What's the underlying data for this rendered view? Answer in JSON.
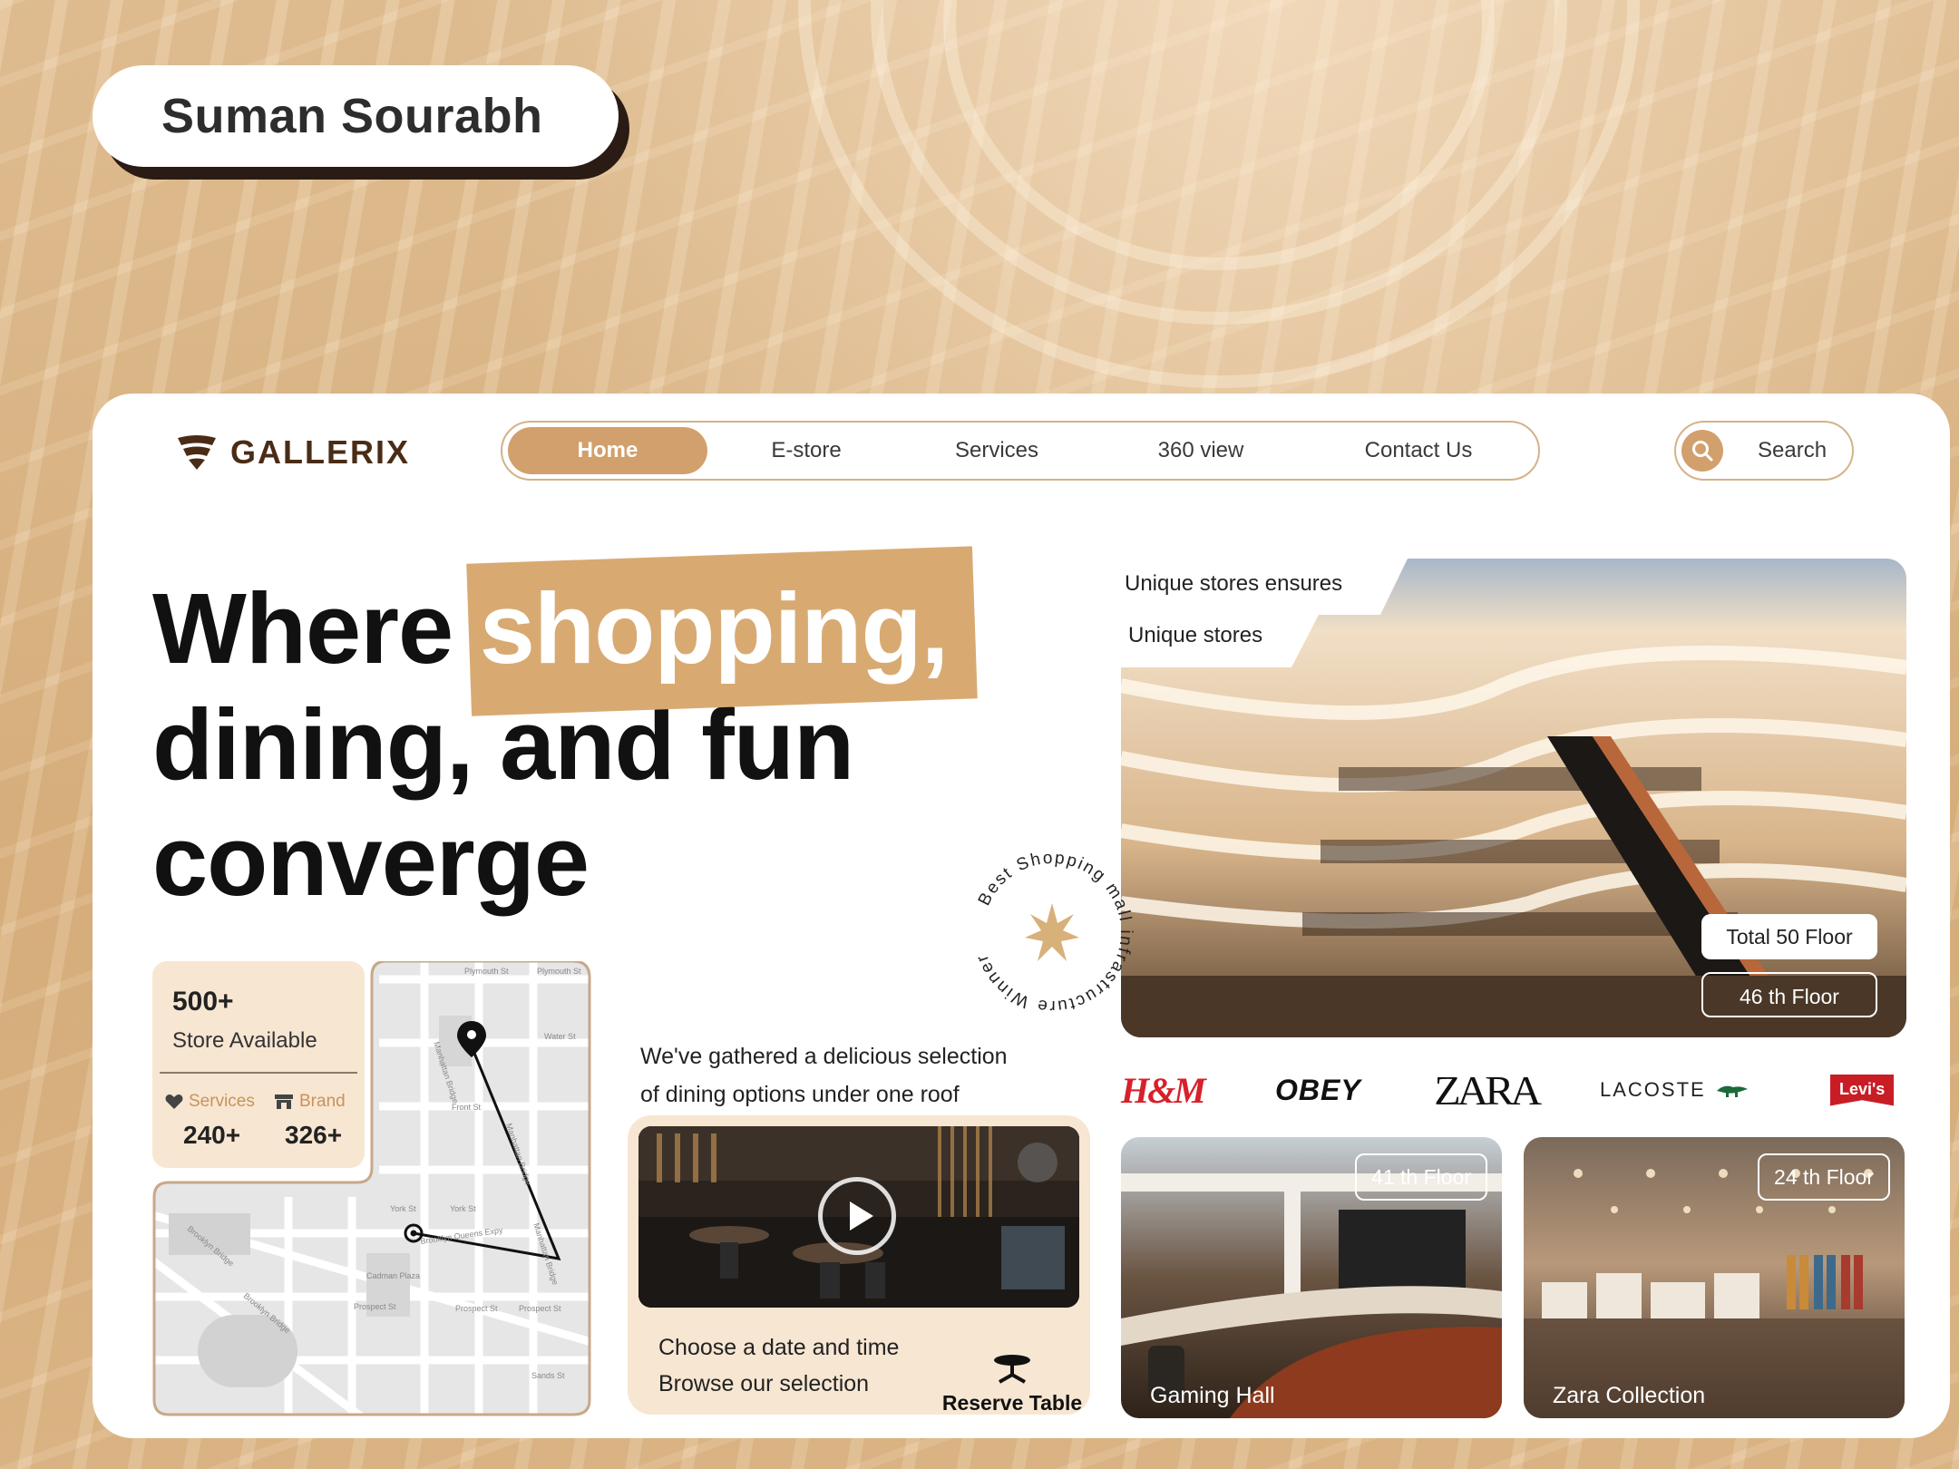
{
  "author": {
    "name": "Suman Sourabh"
  },
  "brand": {
    "name": "GALLERIX",
    "accent": "#d2a06c",
    "dark": "#4a2c16"
  },
  "nav": {
    "items": [
      {
        "label": "Home",
        "active": true
      },
      {
        "label": "E-store"
      },
      {
        "label": "Services"
      },
      {
        "label": "360 view"
      },
      {
        "label": "Contact Us"
      }
    ]
  },
  "search": {
    "label": "Search",
    "icon": "search-icon"
  },
  "hero": {
    "line1_prefix": "Where",
    "line1_highlight": "shopping,",
    "line2": "dining, and fun",
    "line3": "converge"
  },
  "stats": {
    "stores_count": "500+",
    "stores_label": "Store Available",
    "services_label": "Services",
    "services_count": "240+",
    "brand_label": "Brand",
    "brand_count": "326+"
  },
  "map": {
    "streets": [
      "Plymouth St",
      "Plymouth St",
      "Water St",
      "Front St",
      "York St",
      "York St",
      "Brooklyn Queens Expy",
      "Prospect St",
      "Prospect St",
      "Sands St",
      "Manhattan Bridge",
      "Jay St",
      "Pearl St",
      "Adams St",
      "Washington St",
      "Brooklyn Bridge",
      "Cadman Plaza"
    ]
  },
  "dining": {
    "intro_line1": "We've gathered a delicious selection",
    "intro_line2": "of dining options under one roof",
    "desc_line1": "Choose a date and time",
    "desc_line2": "Browse our selection",
    "reserve_label": "Reserve Table"
  },
  "gallery": {
    "tab_primary": "Unique stores ensures",
    "tab_secondary": "Unique stores",
    "total_floors": "Total 50 Floor",
    "current_floor": "46 th Floor",
    "badge_text": "Best Shopping mall infrastructure Winner",
    "brands": [
      "H&M",
      "OBEY",
      "ZARA",
      "LACOSTE",
      "Levi's"
    ],
    "tiles": [
      {
        "floor": "41 th Floor",
        "caption": "Gaming Hall"
      },
      {
        "floor": "24 th Floor",
        "caption": "Zara Collection"
      }
    ]
  }
}
